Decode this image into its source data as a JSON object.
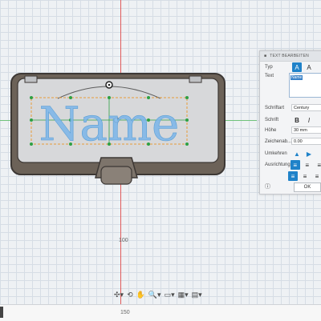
{
  "dialog": {
    "title": "TEXT BEARBEITEN",
    "fields": {
      "typ_label": "Typ",
      "text_label": "Text",
      "text_value": "Name",
      "font_label": "Schriftart",
      "font_value": "Century",
      "style_label": "Schrift",
      "height_label": "Höhe",
      "height_value": "30 mm",
      "spacing_label": "Zeichenab...",
      "spacing_value": "0.00",
      "flip_label": "Umkehren",
      "align_label": "Ausrichtung"
    },
    "ok_label": "OK"
  },
  "viewport": {
    "model_text": "Name",
    "axis_label": "100",
    "footer_label": "150"
  },
  "colors": {
    "accent": "#1f82c9",
    "axis_red": "#e05a5a",
    "axis_green": "#6fc27a",
    "sketch_green": "#2ea043",
    "sketch_orange": "#e79b3a",
    "text_fill": "#7fb7e8"
  },
  "icons": {
    "toolbar": [
      "move-icon",
      "orbit-icon",
      "pan-icon",
      "zoom-icon",
      "fit-icon",
      "display-mode-icon",
      "grid-icon"
    ],
    "dialog": [
      "text-type-icon",
      "text-on-path-icon",
      "bold-icon",
      "italic-icon",
      "flip-horizontal-icon",
      "flip-vertical-icon",
      "align-left-icon",
      "align-center-icon",
      "align-right-icon",
      "info-icon"
    ]
  }
}
